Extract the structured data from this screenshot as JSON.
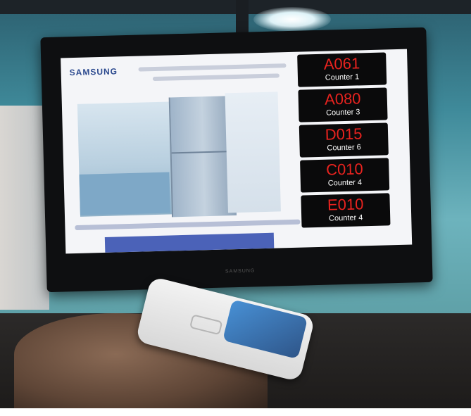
{
  "tv": {
    "brand_logo": "SAMSUNG",
    "bezel_brand": "SAMSUNG"
  },
  "queue": [
    {
      "number": "A061",
      "counter": "Counter 1"
    },
    {
      "number": "A080",
      "counter": "Counter 3"
    },
    {
      "number": "D015",
      "counter": "Counter 6"
    },
    {
      "number": "C010",
      "counter": "Counter 4"
    },
    {
      "number": "E010",
      "counter": "Counter 4"
    }
  ],
  "colors": {
    "ticket_number": "#e8231f",
    "ticket_counter": "#ffffff",
    "ticket_bg": "#0a0a0b"
  }
}
